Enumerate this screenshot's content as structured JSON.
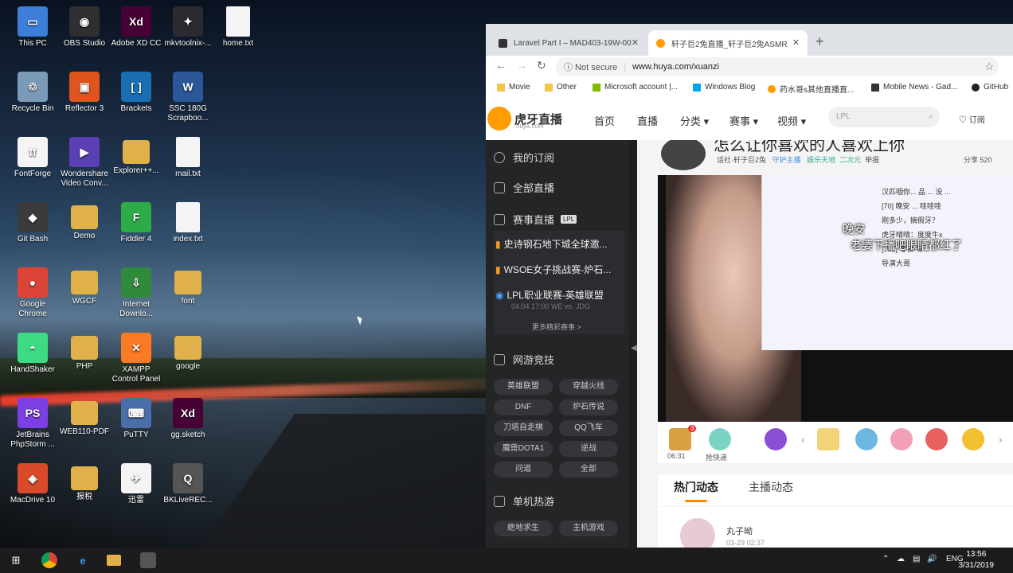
{
  "desktop": {
    "icons": [
      {
        "label": "This PC",
        "color": "#3d7fd8",
        "glyph": "computer-icon",
        "sym": "▭"
      },
      {
        "label": "OBS Studio",
        "color": "#302e31",
        "glyph": "obs-icon",
        "sym": "◉"
      },
      {
        "label": "Adobe XD CC",
        "color": "#470137",
        "glyph": "adobe-xd-icon",
        "sym": "Xd"
      },
      {
        "label": "mkvtoolnix-...",
        "color": "#2a2a30",
        "glyph": "mkvtoolnix-icon",
        "sym": "✦"
      },
      {
        "label": "home.txt",
        "color": "#f4f4f4",
        "glyph": "text-file-icon",
        "sym": ""
      },
      {
        "label": "Recycle Bin",
        "color": "#7a9ab8",
        "glyph": "recycle-bin-icon",
        "sym": "♲"
      },
      {
        "label": "Reflector 3",
        "color": "#e0541e",
        "glyph": "reflector-icon",
        "sym": "▣"
      },
      {
        "label": "Brackets",
        "color": "#1a6fb3",
        "glyph": "brackets-icon",
        "sym": "[ ]"
      },
      {
        "label": "SSC 180G Scrapboo...",
        "color": "#2b579a",
        "glyph": "word-document-icon",
        "sym": "W"
      },
      {
        "label": "FontForge",
        "color": "#f4f4f4",
        "glyph": "fontforge-icon",
        "sym": "ff"
      },
      {
        "label": "Wondershare Video Conv...",
        "color": "#5b3fb5",
        "glyph": "wondershare-icon",
        "sym": "▶"
      },
      {
        "label": "Explorer++...",
        "color": "#e0b14a",
        "glyph": "folder-icon",
        "sym": ""
      },
      {
        "label": "mail.txt",
        "color": "#f4f4f4",
        "glyph": "text-file-icon",
        "sym": ""
      },
      {
        "label": "Git Bash",
        "color": "#3b3b3b",
        "glyph": "git-bash-icon",
        "sym": "◆"
      },
      {
        "label": "Demo",
        "color": "#e0b14a",
        "glyph": "folder-icon",
        "sym": ""
      },
      {
        "label": "Fiddler 4",
        "color": "#2eaa47",
        "glyph": "fiddler-icon",
        "sym": "F"
      },
      {
        "label": "index.txt",
        "color": "#f4f4f4",
        "glyph": "text-file-icon",
        "sym": ""
      },
      {
        "label": "Google Chrome",
        "color": "#db4437",
        "glyph": "chrome-icon",
        "sym": "●"
      },
      {
        "label": "WGCF",
        "color": "#e0b14a",
        "glyph": "folder-icon",
        "sym": ""
      },
      {
        "label": "Internet Downlo...",
        "color": "#2f8a3c",
        "glyph": "idm-icon",
        "sym": "⇩"
      },
      {
        "label": "font",
        "color": "#e0b14a",
        "glyph": "folder-icon",
        "sym": ""
      },
      {
        "label": "HandShaker",
        "color": "#3ddc84",
        "glyph": "android-icon",
        "sym": "◓"
      },
      {
        "label": "PHP",
        "color": "#e0b14a",
        "glyph": "folder-icon",
        "sym": ""
      },
      {
        "label": "XAMPP Control Panel",
        "color": "#fb7a24",
        "glyph": "xampp-icon",
        "sym": "✕"
      },
      {
        "label": "google",
        "color": "#e0b14a",
        "glyph": "folder-icon",
        "sym": ""
      },
      {
        "label": "JetBrains PhpStorm ...",
        "color": "#7b3fe4",
        "glyph": "phpstorm-icon",
        "sym": "PS"
      },
      {
        "label": "WEB110-PDF",
        "color": "#e0b14a",
        "glyph": "folder-icon",
        "sym": ""
      },
      {
        "label": "PuTTY",
        "color": "#4a6ea8",
        "glyph": "putty-icon",
        "sym": "⌨"
      },
      {
        "label": "gg.sketch",
        "color": "#470137",
        "glyph": "adobe-xd-file-icon",
        "sym": "Xd"
      },
      {
        "label": "MacDrive 10",
        "color": "#d94a2a",
        "glyph": "macdrive-icon",
        "sym": "◈"
      },
      {
        "label": "报税",
        "color": "#e0b14a",
        "glyph": "folder-icon",
        "sym": ""
      },
      {
        "label": "迅雷",
        "color": "#f4f4f4",
        "glyph": "xunlei-icon",
        "sym": "✈"
      },
      {
        "label": "BKLiveREC...",
        "color": "#555555",
        "glyph": "bklive-recorder-icon",
        "sym": "Q"
      }
    ]
  },
  "browser": {
    "tabs": [
      {
        "label": "Laravel Part I – MAD403-19W-00",
        "fav_color": "#333333"
      },
      {
        "label": "轩子巨2兔直播_轩子巨2兔ASMR",
        "fav_color": "#ff9c00"
      }
    ],
    "new_tab": "+",
    "close": "✕",
    "back": "←",
    "forward": "→",
    "reload": "↻",
    "not_secure": "ⓘ Not secure",
    "url": "www.huya.com/xuanzi",
    "star": "☆",
    "bookmarks": [
      "Movie",
      "Other",
      "Microsoft account |...",
      "Windows Blog",
      "药水哥s其他直播直...",
      "Mobile News - Gad...",
      "GitHub"
    ]
  },
  "huya": {
    "logo_text": "虎牙直播",
    "logo_sub": "huya.com",
    "nav": [
      "首页",
      "直播",
      "分类 ▾",
      "赛事 ▾",
      "视频 ▾"
    ],
    "search_placeholder": "LPL",
    "subscribe": "♡ 订阅",
    "sidebar": {
      "my_subs": "我的订阅",
      "all_live": "全部直播",
      "esports": "赛事直播",
      "esports_badge": "LPL",
      "matches": [
        "史诗钢石地下城全球邀...",
        "WSOE女子挑战赛-炉石...",
        "LPL职业联赛-英雄联盟"
      ],
      "match_meta": "04.04 17:00 WE vs. JDG",
      "more_matches": "更多精彩赛事 >",
      "online_games": "网游竞技",
      "game_pills": [
        "英雄联盟",
        "穿越火线",
        "DNF",
        "炉石传说",
        "刀塔自走棋",
        "QQ飞车",
        "魔兽DOTA1",
        "逆战",
        "问道",
        "全部"
      ],
      "single_games": "单机热游",
      "single_pills": [
        "绝地求生",
        "主机游戏"
      ]
    },
    "room": {
      "title": "怎么让你喜欢的人喜欢上你",
      "anchor_line": "话社·轩子巨2兔",
      "guard": "守护主播",
      "category": "娱乐天地",
      "sub_cat": "二次元",
      "report": "举报",
      "share": "分享 520",
      "subtitle1": "晚安",
      "subtitle2": "老婆下播吧眼睛都红了",
      "chat_lines": [
        "汉匹咽你... 品 ... 没 ...",
        "[70] 晚安 ... 哇哇哇",
        "刚多少，摘假牙？",
        "虎牙晴晴：度度牛x",
        "[701] 零食-零...",
        "导演大哥"
      ]
    },
    "gifts": {
      "timer": "06:31",
      "fast": "抢快递",
      "badge": "3",
      "prev": "‹",
      "next": "›"
    },
    "tabs": [
      "热门动态",
      "主播动态"
    ],
    "feed": {
      "name": "丸子呦",
      "date": "03-29 02:37"
    }
  },
  "taskbar": {
    "start": "⊞",
    "tray": [
      "⌃",
      "☁",
      "▤",
      "🔊",
      "ENG"
    ],
    "time": "13:56",
    "date": "3/31/2019"
  }
}
